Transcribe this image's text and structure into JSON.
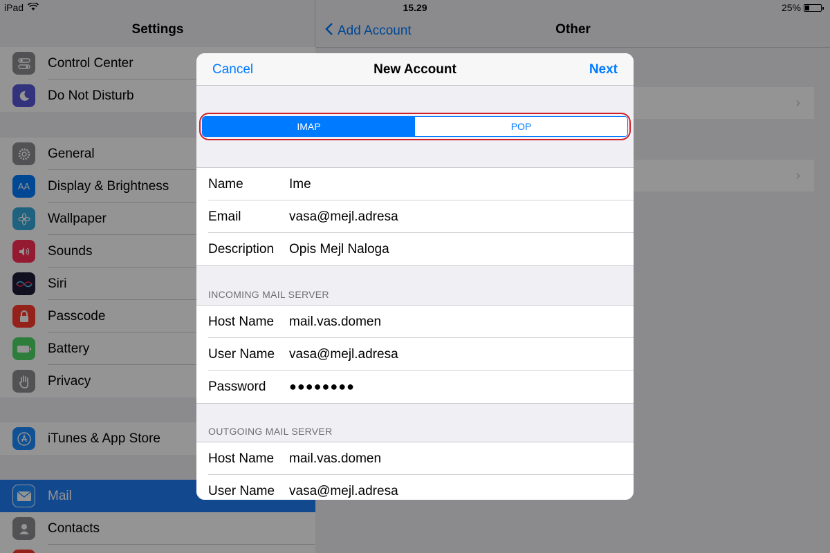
{
  "status_bar": {
    "device": "iPad",
    "time": "15.29",
    "battery_percent": "25%",
    "battery_level": 0.25
  },
  "settings": {
    "title": "Settings",
    "items": [
      {
        "label": "Control Center",
        "icon": "control-center-icon",
        "color": "#8e8e93"
      },
      {
        "label": "Do Not Disturb",
        "icon": "moon-icon",
        "color": "#5856d6"
      },
      {
        "label": "General",
        "icon": "gear-icon",
        "color": "#8e8e93"
      },
      {
        "label": "Display & Brightness",
        "icon": "display-icon",
        "color": "#007aff"
      },
      {
        "label": "Wallpaper",
        "icon": "wallpaper-icon",
        "color": "#34aadc"
      },
      {
        "label": "Sounds",
        "icon": "speaker-icon",
        "color": "#ff2d55"
      },
      {
        "label": "Siri",
        "icon": "siri-icon",
        "color": "#1c1c3a"
      },
      {
        "label": "Passcode",
        "icon": "lock-icon",
        "color": "#ff3b30"
      },
      {
        "label": "Battery",
        "icon": "battery-icon",
        "color": "#4cd964"
      },
      {
        "label": "Privacy",
        "icon": "hand-icon",
        "color": "#8e8e93"
      },
      {
        "label": "iTunes & App Store",
        "icon": "app-store-icon",
        "color": "#1a8cff"
      },
      {
        "label": "Mail",
        "icon": "mail-icon",
        "color": "#1a8cff"
      },
      {
        "label": "Contacts",
        "icon": "contacts-icon",
        "color": "#8e8e93"
      }
    ]
  },
  "detail": {
    "back_label": "Add Account",
    "title": "Other"
  },
  "modal": {
    "cancel_label": "Cancel",
    "title": "New Account",
    "next_label": "Next",
    "segments": {
      "imap": "IMAP",
      "pop": "POP",
      "selected": "IMAP"
    },
    "account": {
      "name_label": "Name",
      "name_value": "Ime",
      "email_label": "Email",
      "email_value": "vasa@mejl.adresa",
      "description_label": "Description",
      "description_value": "Opis Mejl Naloga"
    },
    "incoming": {
      "header": "INCOMING MAIL SERVER",
      "host_label": "Host Name",
      "host_value": "mail.vas.domen",
      "user_label": "User Name",
      "user_value": "vasa@mejl.adresa",
      "password_label": "Password",
      "password_value": "●●●●●●●●"
    },
    "outgoing": {
      "header": "OUTGOING MAIL SERVER",
      "host_label": "Host Name",
      "host_value": "mail.vas.domen",
      "user_label": "User Name",
      "user_value": "vasa@mejl.adresa"
    }
  }
}
